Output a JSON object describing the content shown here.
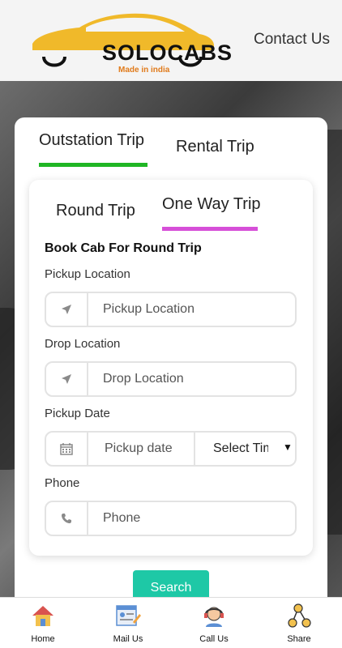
{
  "header": {
    "logo_text": "SOLOCABS",
    "logo_tagline": "Made in india",
    "contact_link": "Contact Us"
  },
  "trip_tabs": {
    "outstation": "Outstation Trip",
    "rental": "Rental Trip",
    "active": "Outstation Trip"
  },
  "sub_tabs": {
    "round": "Round Trip",
    "one_way": "One Way Trip",
    "active": "One Way Trip"
  },
  "form": {
    "title": "Book Cab For Round Trip",
    "pickup_label": "Pickup Location",
    "pickup_placeholder": "Pickup Location",
    "drop_label": "Drop Location",
    "drop_placeholder": "Drop Location",
    "date_label": "Pickup Date",
    "date_placeholder": "Pickup date",
    "time_selected": "Select Time",
    "phone_label": "Phone",
    "phone_placeholder": "Phone",
    "submit": "Search"
  },
  "bottom_nav": [
    {
      "label": "Home",
      "icon": "home-icon"
    },
    {
      "label": "Mail Us",
      "icon": "mail-icon"
    },
    {
      "label": "Call Us",
      "icon": "call-agent-icon"
    },
    {
      "label": "Share",
      "icon": "share-icon"
    }
  ],
  "colors": {
    "outstation_underline": "#1fb624",
    "oneway_underline": "#d64fd8",
    "search_button": "#1ec8a6",
    "logo_car": "#f0b92a",
    "logo_tagline": "#e07a1a"
  }
}
